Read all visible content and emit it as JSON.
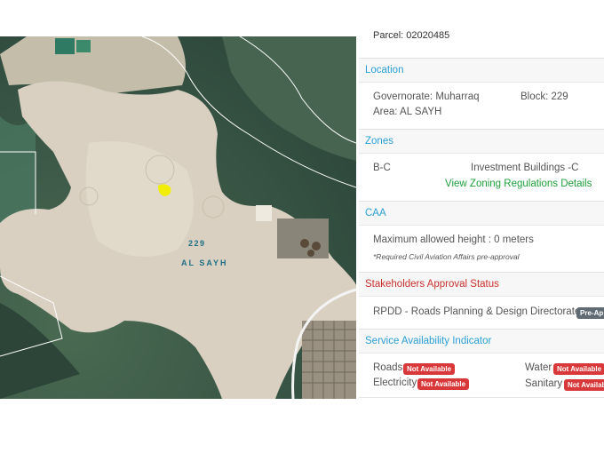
{
  "map": {
    "block_number": "229",
    "area_name": "AL SAYH"
  },
  "panel": {
    "parcel_text": "Parcel: 02020485",
    "location": {
      "header": "Location",
      "governorate": "Governorate: Muharraq",
      "block": "Block: 229",
      "area": "Area: AL SAYH"
    },
    "zones": {
      "header": "Zones",
      "code": "B-C",
      "description": "Investment Buildings -C",
      "link": "View Zoning Regulations Details"
    },
    "caa": {
      "header": "CAA",
      "max_height": "Maximum allowed height : 0 meters",
      "note": "*Required Civil Aviation Affairs pre-approval"
    },
    "stakeholders": {
      "header": "Stakeholders Approval Status",
      "directorate": "RPDD - Roads Planning & Design Directorate",
      "badge": "Pre-Ap"
    },
    "services": {
      "header": "Service Availability Indicator",
      "roads_label": "Roads",
      "roads_status": "Not Available",
      "water_label": "Water",
      "water_status": "Not Available",
      "electricity_label": "Electricity",
      "electricity_status": "Not Available",
      "sanitary_label": "Sanitary",
      "sanitary_status": "Not Available"
    }
  },
  "colors": {
    "header_blue": "#2a9fd6",
    "header_red": "#c9302c",
    "link_green": "#1e9e3a",
    "badge_red": "#d9383a",
    "badge_gray": "#5f6a72",
    "parcel_highlight": "#f2ee00"
  }
}
